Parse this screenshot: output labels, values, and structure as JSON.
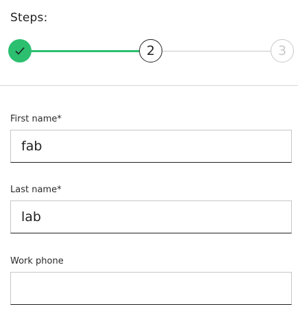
{
  "steps": {
    "title": "Steps:",
    "items": [
      {
        "state": "completed",
        "icon": "check-icon"
      },
      {
        "state": "current",
        "number": "2"
      },
      {
        "state": "upcoming",
        "number": "3"
      }
    ],
    "progress": {
      "completed_color": "#2bbf6f",
      "pending_color": "#c8c8c8"
    }
  },
  "form": {
    "first_name": {
      "label": "First name*",
      "value": "fab"
    },
    "last_name": {
      "label": "Last name*",
      "value": "lab"
    },
    "work_phone": {
      "label": "Work phone",
      "value": ""
    }
  }
}
